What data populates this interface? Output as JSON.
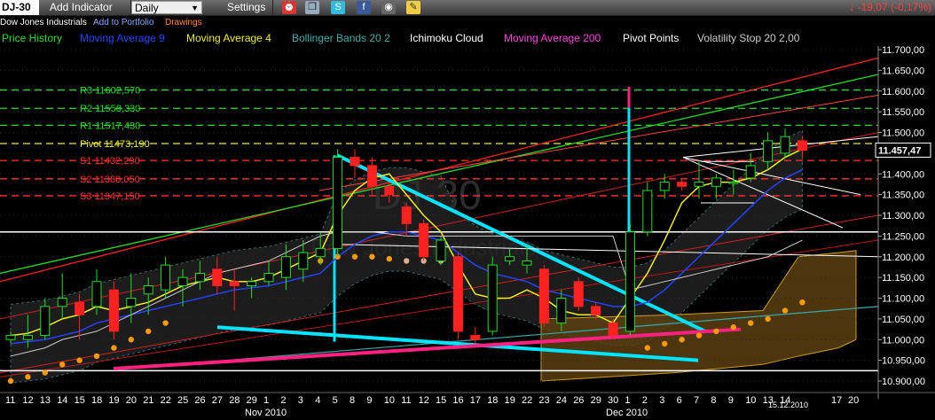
{
  "toolbar": {
    "symbol": "DJ-30",
    "add_indicator": "Add Indicator",
    "period": "Daily",
    "settings": "Settings",
    "change": "-19,07 (-0,17%)"
  },
  "subbar": {
    "instrument": "Dow Jones Industrials",
    "add_portfolio": "Add to Portfolio",
    "drawings": "Drawings"
  },
  "legend": [
    {
      "label": "Price History",
      "color": "#22dd22"
    },
    {
      "label": "Moving Average 9",
      "color": "#2244ff"
    },
    {
      "label": "Moving Average 4",
      "color": "#eeee22"
    },
    {
      "label": "Bollinger Bands 20 2",
      "color": "#44aaaa"
    },
    {
      "label": "Ichimoku Cloud",
      "color": "#ffffff"
    },
    {
      "label": "Moving Average 200",
      "color": "#ff44dd"
    },
    {
      "label": "Pivot Points",
      "color": "#ffffff"
    },
    {
      "label": "Volatility Stop 20 2,00",
      "color": "#cccccc"
    }
  ],
  "watermark": "DJ-30",
  "watermark_sub": "Dow Jones Industrials",
  "chart_data": {
    "type": "candlestick",
    "y_axis": {
      "min": 10900,
      "max": 11700,
      "step": 50,
      "tick_labels": [
        "11.700,00",
        "11.650,00",
        "11.600,00",
        "11.550,00",
        "11.500,00",
        "11.450,00",
        "11.400,00",
        "11.350,00",
        "11.300,00",
        "11.250,00",
        "11.200,00",
        "11.150,00",
        "11.100,00",
        "11.050,00",
        "11.000,00",
        "10.950,00",
        "10.900,00"
      ]
    },
    "last_price": 11457.47,
    "last_price_label": "11.457,47",
    "x_axis": {
      "tick_labels": [
        "11",
        "12",
        "13",
        "14",
        "15",
        "18",
        "19",
        "20",
        "21",
        "22",
        "25",
        "26",
        "27",
        "28",
        "29",
        "1",
        "2",
        "3",
        "4",
        "5",
        "8",
        "9",
        "10",
        "11",
        "12",
        "15",
        "16",
        "17",
        "18",
        "19",
        "22",
        "23",
        "24",
        "26",
        "29",
        "30",
        "1",
        "2",
        "3",
        "6",
        "7",
        "8",
        "9",
        "10",
        "13",
        "14",
        "15.12.2010",
        "17",
        "20"
      ],
      "month_labels": [
        "Nov 2010",
        "Dec 2010"
      ]
    },
    "pivot_points": [
      {
        "name": "R3",
        "label": "R3 11602,570",
        "value": 11602.57,
        "color": "#22dd22"
      },
      {
        "name": "R2",
        "label": "R2 11558,330",
        "value": 11558.33,
        "color": "#22dd22"
      },
      {
        "name": "R1",
        "label": "R1 11517,430",
        "value": 11517.43,
        "color": "#22dd22"
      },
      {
        "name": "Pivot",
        "label": "Pivot 11473,190",
        "value": 11473.19,
        "color": "#eeee22"
      },
      {
        "name": "S1",
        "label": "S1 11432,290",
        "value": 11432.29,
        "color": "#ff3030"
      },
      {
        "name": "S2",
        "label": "S2 11388,050",
        "value": 11388.05,
        "color": "#ff3030"
      },
      {
        "name": "S3",
        "label": "S3 11347,150",
        "value": 11347.15,
        "color": "#ff3030"
      }
    ],
    "candles": [
      {
        "d": "11",
        "o": 11000,
        "h": 11020,
        "l": 10990,
        "c": 11010
      },
      {
        "d": "12",
        "o": 11000,
        "h": 11060,
        "l": 10980,
        "c": 11010
      },
      {
        "d": "13",
        "o": 11010,
        "h": 11100,
        "l": 11000,
        "c": 11080
      },
      {
        "d": "14",
        "o": 11080,
        "h": 11160,
        "l": 11050,
        "c": 11100
      },
      {
        "d": "15",
        "o": 11090,
        "h": 11110,
        "l": 11000,
        "c": 11060
      },
      {
        "d": "18",
        "o": 11080,
        "h": 11170,
        "l": 11060,
        "c": 11140
      },
      {
        "d": "19",
        "o": 11120,
        "h": 11140,
        "l": 11000,
        "c": 11020
      },
      {
        "d": "20",
        "o": 11080,
        "h": 11160,
        "l": 11040,
        "c": 11100
      },
      {
        "d": "21",
        "o": 11110,
        "h": 11150,
        "l": 11060,
        "c": 11130
      },
      {
        "d": "22",
        "o": 11120,
        "h": 11200,
        "l": 11100,
        "c": 11180
      },
      {
        "d": "25",
        "o": 11130,
        "h": 11170,
        "l": 11080,
        "c": 11150
      },
      {
        "d": "26",
        "o": 11140,
        "h": 11190,
        "l": 11120,
        "c": 11160
      },
      {
        "d": "27",
        "o": 11170,
        "h": 11200,
        "l": 11110,
        "c": 11130
      },
      {
        "d": "28",
        "o": 11140,
        "h": 11170,
        "l": 11070,
        "c": 11130
      },
      {
        "d": "29",
        "o": 11130,
        "h": 11150,
        "l": 11100,
        "c": 11140
      },
      {
        "d": "1",
        "o": 11140,
        "h": 11190,
        "l": 11130,
        "c": 11160
      },
      {
        "d": "2",
        "o": 11150,
        "h": 11230,
        "l": 11120,
        "c": 11200
      },
      {
        "d": "3",
        "o": 11170,
        "h": 11240,
        "l": 11140,
        "c": 11210
      },
      {
        "d": "4",
        "o": 11200,
        "h": 11260,
        "l": 11180,
        "c": 11220
      },
      {
        "d": "5",
        "o": 11220,
        "h": 11460,
        "l": 11200,
        "c": 11440
      },
      {
        "d": "8",
        "o": 11440,
        "h": 11460,
        "l": 11390,
        "c": 11420
      },
      {
        "d": "9",
        "o": 11420,
        "h": 11440,
        "l": 11350,
        "c": 11370
      },
      {
        "d": "10",
        "o": 11370,
        "h": 11380,
        "l": 11330,
        "c": 11350
      },
      {
        "d": "11",
        "o": 11320,
        "h": 11330,
        "l": 11250,
        "c": 11280
      },
      {
        "d": "12",
        "o": 11280,
        "h": 11290,
        "l": 11190,
        "c": 11200
      },
      {
        "d": "15",
        "o": 11190,
        "h": 11250,
        "l": 11180,
        "c": 11240
      },
      {
        "d": "16",
        "o": 11200,
        "h": 11210,
        "l": 11000,
        "c": 11020
      },
      {
        "d": "17",
        "o": 11010,
        "h": 11030,
        "l": 10990,
        "c": 11000
      },
      {
        "d": "18",
        "o": 11020,
        "h": 11200,
        "l": 11010,
        "c": 11180
      },
      {
        "d": "19",
        "o": 11190,
        "h": 11220,
        "l": 11180,
        "c": 11200
      },
      {
        "d": "22",
        "o": 11180,
        "h": 11230,
        "l": 11160,
        "c": 11190
      },
      {
        "d": "23",
        "o": 11170,
        "h": 11180,
        "l": 11030,
        "c": 11040
      },
      {
        "d": "24",
        "o": 11040,
        "h": 11120,
        "l": 11020,
        "c": 11100
      },
      {
        "d": "26",
        "o": 11140,
        "h": 11150,
        "l": 11070,
        "c": 11080
      },
      {
        "d": "29",
        "o": 11080,
        "h": 11090,
        "l": 11050,
        "c": 11060
      },
      {
        "d": "30",
        "o": 11040,
        "h": 11050,
        "l": 11000,
        "c": 11010
      },
      {
        "d": "1",
        "o": 11020,
        "h": 11280,
        "l": 11010,
        "c": 11260
      },
      {
        "d": "2",
        "o": 11260,
        "h": 11380,
        "l": 11250,
        "c": 11360
      },
      {
        "d": "3",
        "o": 11360,
        "h": 11400,
        "l": 11340,
        "c": 11380
      },
      {
        "d": "6",
        "o": 11380,
        "h": 11390,
        "l": 11360,
        "c": 11370
      },
      {
        "d": "7",
        "o": 11370,
        "h": 11430,
        "l": 11340,
        "c": 11380
      },
      {
        "d": "8",
        "o": 11370,
        "h": 11400,
        "l": 11340,
        "c": 11390
      },
      {
        "d": "9",
        "o": 11380,
        "h": 11410,
        "l": 11350,
        "c": 11380
      },
      {
        "d": "10",
        "o": 11390,
        "h": 11450,
        "l": 11380,
        "c": 11420
      },
      {
        "d": "13",
        "o": 11430,
        "h": 11500,
        "l": 11410,
        "c": 11480
      },
      {
        "d": "14",
        "o": 11450,
        "h": 11510,
        "l": 11440,
        "c": 11490
      },
      {
        "d": "15.12.2010",
        "o": 11480,
        "h": 11490,
        "l": 11440,
        "c": 11457
      }
    ],
    "moving_average_4": [
      11010,
      11015,
      11030,
      11050,
      11060,
      11080,
      11070,
      11080,
      11090,
      11110,
      11130,
      11140,
      11150,
      11140,
      11140,
      11150,
      11170,
      11190,
      11210,
      11300,
      11360,
      11390,
      11400,
      11350,
      11300,
      11260,
      11180,
      11110,
      11100,
      11100,
      11120,
      11100,
      11070,
      11060,
      11060,
      11040,
      11100,
      11160,
      11240,
      11330,
      11370,
      11380,
      11380,
      11390,
      11410,
      11440,
      11460
    ],
    "moving_average_9": [
      10990,
      10995,
      11000,
      11010,
      11020,
      11040,
      11050,
      11060,
      11070,
      11080,
      11090,
      11100,
      11110,
      11120,
      11125,
      11130,
      11140,
      11150,
      11160,
      11200,
      11230,
      11250,
      11260,
      11260,
      11250,
      11240,
      11210,
      11180,
      11160,
      11150,
      11140,
      11120,
      11110,
      11100,
      11090,
      11080,
      11080,
      11090,
      11120,
      11160,
      11200,
      11240,
      11280,
      11320,
      11360,
      11390,
      11410
    ],
    "moving_average_200": [
      10930,
      10975,
      11010
    ],
    "volatility_stop": [
      10960,
      10970,
      10980,
      11000,
      11010,
      11020,
      11040,
      11060,
      11080,
      11100,
      11120,
      11140,
      11160,
      11170,
      11180,
      11190,
      11210,
      11230,
      11250,
      11260,
      11260,
      11260,
      11255,
      11250,
      11250,
      11250,
      11250,
      11250,
      11250,
      11250,
      11250,
      11250,
      11250,
      11250,
      11250,
      11250,
      11120,
      11130,
      11140,
      11150,
      11160,
      11170,
      11180,
      11190,
      11200,
      11220,
      11240
    ],
    "ichimoku_cloud": {
      "upper": [
        11050,
        11060,
        11070,
        11200,
        11210,
        11215
      ],
      "lower": [
        10900,
        10920,
        10940,
        10960,
        10980,
        11000
      ]
    }
  }
}
